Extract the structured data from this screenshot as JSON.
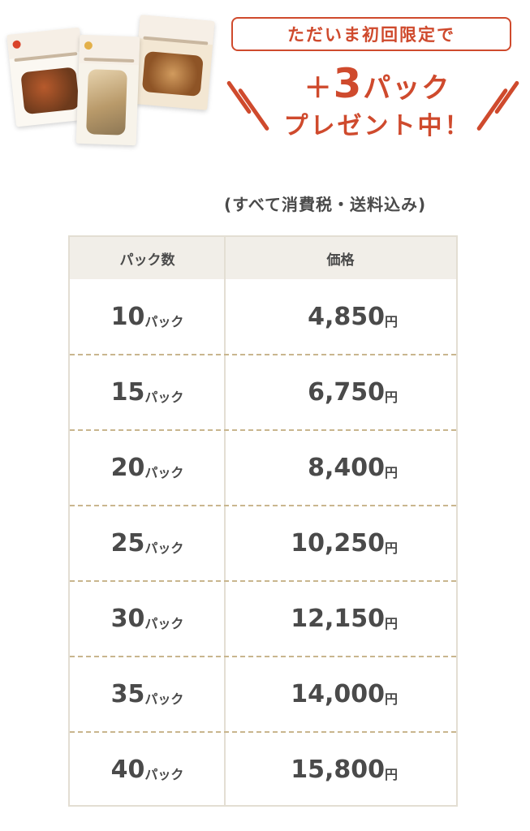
{
  "promo": {
    "box_text": "ただいま初回限定で",
    "plus_prefix": "＋",
    "plus_number": "3",
    "plus_suffix": "パック",
    "line2": "プレゼント中！",
    "accent_color": "#cf4a2d"
  },
  "tax_note": "(すべて消費税・送料込み)",
  "table": {
    "headers": {
      "qty": "パック数",
      "price": "価格"
    },
    "qty_unit": "パック",
    "price_unit": "円",
    "rows": [
      {
        "qty": "10",
        "price": "4,850"
      },
      {
        "qty": "15",
        "price": "6,750"
      },
      {
        "qty": "20",
        "price": "8,400"
      },
      {
        "qty": "25",
        "price": "10,250"
      },
      {
        "qty": "30",
        "price": "12,150"
      },
      {
        "qty": "35",
        "price": "14,000"
      },
      {
        "qty": "40",
        "price": "15,800"
      }
    ]
  }
}
